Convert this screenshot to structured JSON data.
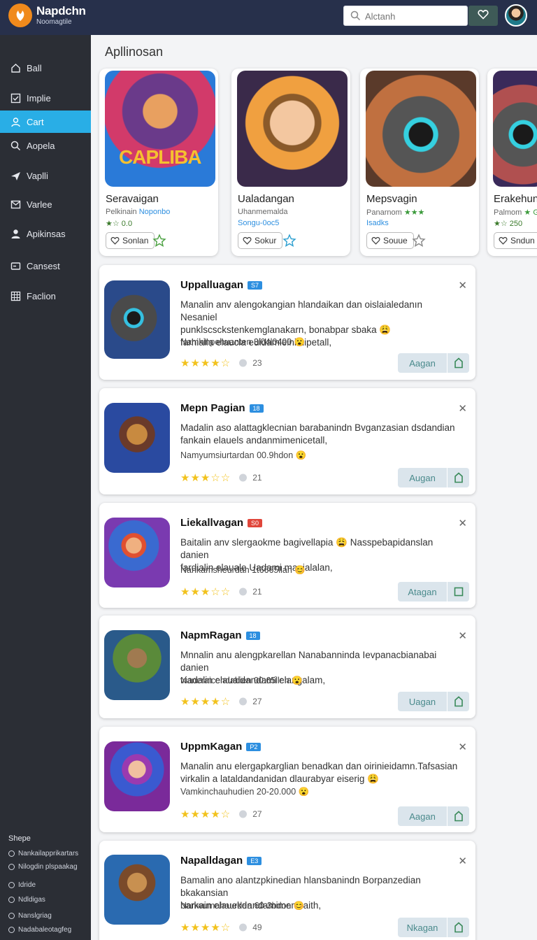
{
  "header": {
    "brand": "Napdchn",
    "subtitle": "Noomagtile",
    "search_placeholder": "Alctanh"
  },
  "sidebar": {
    "items": [
      {
        "label": "Ball",
        "icon": "home-icon"
      },
      {
        "label": "Implie",
        "icon": "checkbox-icon"
      },
      {
        "label": "Cart",
        "icon": "user-icon",
        "active": true
      },
      {
        "label": "Aopela",
        "icon": "search-icon"
      },
      {
        "label": "Vaplli",
        "icon": "send-icon"
      },
      {
        "label": "Varlee",
        "icon": "mail-icon"
      },
      {
        "label": "Apikinsas",
        "icon": "user-icon"
      },
      {
        "label": "Cansest",
        "icon": "window-icon"
      },
      {
        "label": "Faclion",
        "icon": "grid-icon"
      }
    ],
    "footer_heading": "Shepe",
    "footer_links": [
      "Nankailapprikartars",
      "Nilogdin plspaakag",
      "Idride",
      "Ndldigas",
      "Nanslgriag",
      "Nadabaleotagfeg"
    ]
  },
  "main": {
    "section_title": "Apllinosan",
    "featured": [
      {
        "name": "Seravaigan",
        "sub": "Pelkinain",
        "sub_accent": "Noponbo",
        "rating": "★☆ 0.0",
        "button": "Sonlan"
      },
      {
        "name": "Ualadangan",
        "sub": "Uhanmemalda",
        "sub_accent": "Songu-0oc5",
        "rating": "",
        "button": "Sokur"
      },
      {
        "name": "Mepsvagin",
        "sub": "Panarnom",
        "sub_accent": "★★★",
        "rating": "Isadks",
        "button": "Souue"
      },
      {
        "name": "Erakehunf",
        "sub": "Palmom",
        "sub_accent": "★ G",
        "rating": "★☆ 250",
        "button": "Sndun"
      }
    ],
    "list": [
      {
        "title": "Uppalluagan",
        "badge": "S7",
        "desc1": "Manalin anv alengokangian hlandaikan dan oislaialedanın Nesaniel",
        "desc2": "punklscsckstenkemglanakarn, bonabpar sbaka 😩",
        "desc3": "farhialla elaucla euidamleinimipetall,",
        "meta": "Namkinpehuanten 3l04l0400 😮",
        "stars": "★★★★☆",
        "count": "23",
        "action": "Aagan"
      },
      {
        "title": "Mepn Pagian",
        "badge": "18",
        "desc1": "Madalin aso alattagklecnian barabanindn Bvganzasian dsdandian",
        "desc2": "fankain elauels andanmimenicetall,",
        "desc3": "",
        "meta": "Namyumsiurtardan 00.9hdon 😮",
        "stars": "★★★☆☆",
        "count": "21",
        "action": "Augan"
      },
      {
        "title": "Liekallvagan",
        "badge": "S0",
        "desc1": "Baitalin anv slergaokme bagivellapia 😩 Nasspebapidanslan danien",
        "desc2": "fardialin elauale Uadami manialalan,",
        "desc3": "",
        "meta": "Nankamsheurdan 1t6665llan 😊",
        "stars": "★★★☆☆",
        "count": "21",
        "action": "Atagan"
      },
      {
        "title": "NapmRagan",
        "badge": "18",
        "desc1": "Mnnalin anu alengpkarellan Nanabanninda Ievpanacbianabai danien",
        "desc2": "viadalin elaualdandami elangalam,",
        "desc3": "",
        "meta": "Naneraicehdabien 00:65llen 😮",
        "stars": "★★★★☆",
        "count": "27",
        "action": "Uagan"
      },
      {
        "title": "UppmKagan",
        "badge": "P2",
        "desc1": "Manalin anu elergapkarglian benadkan dan oirinieidamn.Tafsasian",
        "desc2": "virkalin a lataldandanidan dlaurabyar eiserig 😩",
        "desc3": "",
        "meta": "Vamkinchauhudien 20-20.000 😮",
        "stars": "★★★★☆",
        "count": "27",
        "action": "Aagan"
      },
      {
        "title": "Napalldagan",
        "badge": "E3",
        "desc1": "Bamalin ano alantzpkinedian hlansbanindn Borpanzedian bkakansian",
        "desc2": "barkain elauekdandamimenicaith,",
        "desc3": "",
        "meta": "Nanwumahaurden 60-3bdon 😊",
        "stars": "★★★★☆",
        "count": "49",
        "action": "Nkagan"
      }
    ]
  },
  "colors": {
    "header_bg": "#27304b",
    "sidebar_bg": "#2b2e35",
    "accent": "#29aee6",
    "badge": "#2d8fe0",
    "star": "#f2c21d"
  }
}
